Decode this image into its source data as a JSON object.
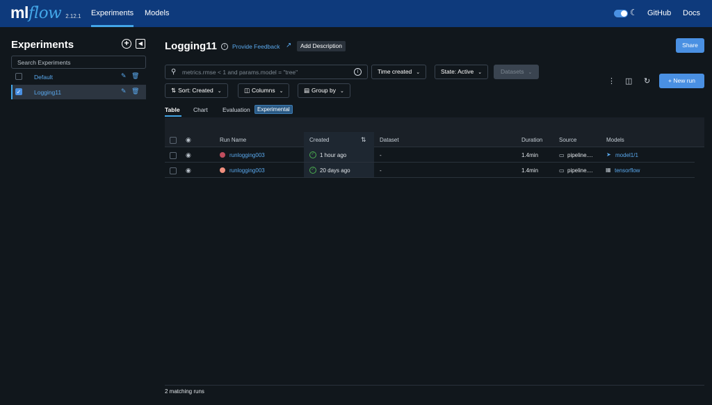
{
  "topbar": {
    "logo_ml": "ml",
    "logo_flow": "flow",
    "version": "2.12.1",
    "nav": [
      {
        "label": "Experiments"
      },
      {
        "label": "Models"
      }
    ],
    "github": "GitHub",
    "docs": "Docs",
    "theme_icon": "moon-icon",
    "accent": "#43a6e8"
  },
  "sidebar": {
    "title": "Experiments",
    "search_placeholder": "Search Experiments",
    "items": [
      {
        "label": "Default",
        "checked": false
      },
      {
        "label": "Logging11",
        "checked": true
      }
    ]
  },
  "main": {
    "title": "Logging11",
    "feedback": "Provide Feedback",
    "add_description": "Add Description",
    "share": "Share",
    "search_placeholder": "metrics.rmse < 1 and params.model = \"tree\"",
    "filters": {
      "time_created": "Time created",
      "state": "State: Active",
      "datasets": "Datasets",
      "sort": "Sort: Created",
      "columns": "Columns",
      "group_by": "Group by"
    },
    "new_run": "+ New run",
    "tabs": [
      "Table",
      "Chart",
      "Evaluation"
    ],
    "experimental_badge": "Experimental"
  },
  "table": {
    "headers": {
      "run_name": "Run Name",
      "created": "Created",
      "dataset": "Dataset",
      "duration": "Duration",
      "source": "Source",
      "models": "Models"
    },
    "rows": [
      {
        "run_name": "runlogging003",
        "color": "#c04e5e",
        "created": "1 hour ago",
        "dataset": "-",
        "duration": "1.4min",
        "source": "pipeline....",
        "model": "model1/1",
        "model_icon": "model-icon"
      },
      {
        "run_name": "runlogging003",
        "color": "#f08f7e",
        "created": "20 days ago",
        "dataset": "-",
        "duration": "1.4min",
        "source": "pipeline....",
        "model": "tensorflow",
        "model_icon": "tensorflow-icon"
      }
    ],
    "matching": "2 matching runs"
  }
}
